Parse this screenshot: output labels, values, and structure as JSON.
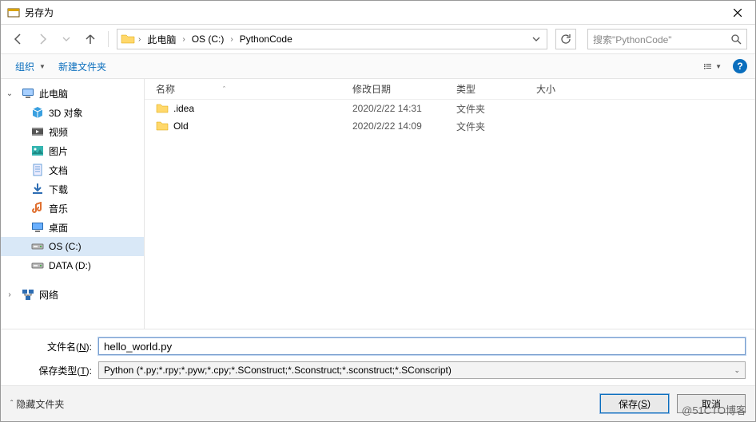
{
  "window": {
    "title": "另存为"
  },
  "nav": {
    "breadcrumbs": [
      "此电脑",
      "OS (C:)",
      "PythonCode"
    ],
    "search_placeholder": "搜索\"PythonCode\""
  },
  "toolbar": {
    "organize": "组织",
    "new_folder": "新建文件夹"
  },
  "sidebar": {
    "root": "此电脑",
    "items": [
      {
        "label": "3D 对象",
        "icon": "cube"
      },
      {
        "label": "视频",
        "icon": "video"
      },
      {
        "label": "图片",
        "icon": "image"
      },
      {
        "label": "文档",
        "icon": "doc"
      },
      {
        "label": "下载",
        "icon": "download"
      },
      {
        "label": "音乐",
        "icon": "music"
      },
      {
        "label": "桌面",
        "icon": "desktop"
      },
      {
        "label": "OS (C:)",
        "icon": "drive",
        "selected": true
      },
      {
        "label": "DATA (D:)",
        "icon": "drive"
      }
    ],
    "network": "网络"
  },
  "columns": {
    "name": "名称",
    "date": "修改日期",
    "type": "类型",
    "size": "大小"
  },
  "files": [
    {
      "name": ".idea",
      "date": "2020/2/22 14:31",
      "type": "文件夹"
    },
    {
      "name": "Old",
      "date": "2020/2/22 14:09",
      "type": "文件夹"
    }
  ],
  "form": {
    "filename_label_pre": "文件名(",
    "filename_label_key": "N",
    "filename_label_post": "):",
    "filename_value": "hello_world.py",
    "filetype_label_pre": "保存类型(",
    "filetype_label_key": "T",
    "filetype_label_post": "):",
    "filetype_value": "Python (*.py;*.rpy;*.pyw;*.cpy;*.SConstruct;*.Sconstruct;*.sconstruct;*.SConscript)"
  },
  "actions": {
    "hide_folders": "隐藏文件夹",
    "save_pre": "保存(",
    "save_key": "S",
    "save_post": ")",
    "cancel": "取消"
  },
  "watermark": "@51CTO博客"
}
